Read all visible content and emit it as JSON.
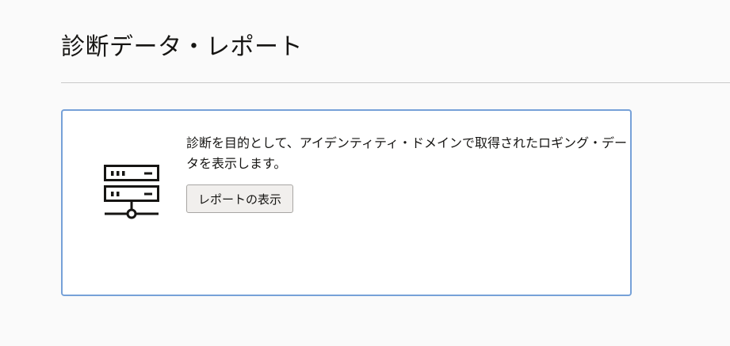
{
  "page": {
    "title": "診断データ・レポート"
  },
  "card": {
    "icon": "server-icon",
    "description": "診断を目的として、アイデンティティ・ドメインで取得されたロギング・データを表示します。",
    "button_label": "レポートの表示"
  },
  "colors": {
    "background": "#fafafa",
    "card_border": "#76a1d8",
    "text": "#161513",
    "button_background": "#f1efed",
    "button_border": "#a8a6a3"
  }
}
